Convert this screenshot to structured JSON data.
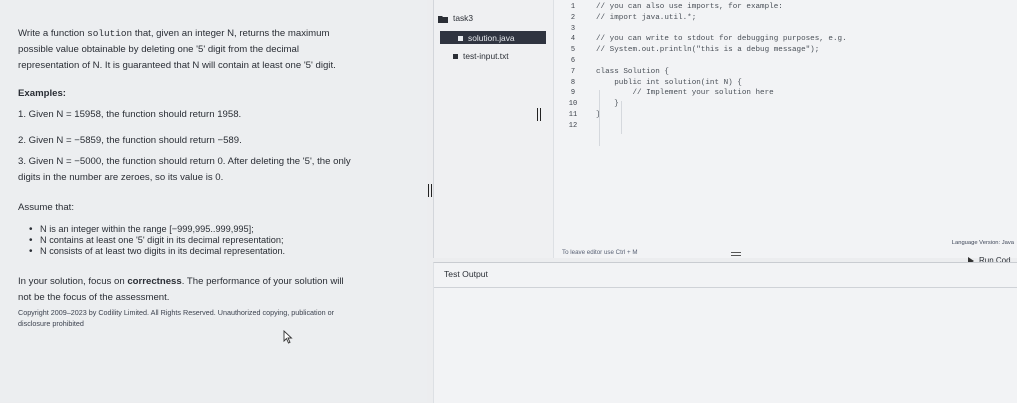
{
  "task": {
    "intro": {
      "line1_pre": "Write a function ",
      "line1_code": "solution",
      "line1_post": " that, given an integer N, returns the maximum",
      "line2": "possible value obtainable by deleting one '5' digit from the decimal",
      "line3": "representation of N. It is guaranteed that N will contain at least one '5' digit."
    },
    "examples_heading": "Examples:",
    "example1": "1. Given N = 15958, the function should return 1958.",
    "example2": "2. Given N = −5859, the function should return −589.",
    "example3_line1": "3. Given N = −5000, the function should return 0. After deleting the '5', the only",
    "example3_line2": "digits in the number are zeroes, so its value is 0.",
    "assume": "Assume that:",
    "assumptions": [
      "N is an integer within the range [−999,995..999,995];",
      "N contains at least one '5' digit in its decimal representation;",
      "N consists of at least two digits in its decimal representation."
    ],
    "focus": {
      "pre": "In your solution, focus on ",
      "bold": "correctness",
      "post": ". The performance of your solution will",
      "line2": "not be the focus of the assessment."
    },
    "copyright_line1": "Copyright 2009–2023 by Codility Limited. All Rights Reserved. Unauthorized copying, publication or",
    "copyright_line2": "disclosure prohibited"
  },
  "file_tree": {
    "folder": "task3",
    "files": [
      "solution.java",
      "test-input.txt"
    ],
    "selected": "solution.java"
  },
  "editor": {
    "line_numbers": [
      "1",
      "2",
      "3",
      "4",
      "5",
      "6",
      "7",
      "8",
      "9",
      "10",
      "11",
      "12"
    ],
    "lines": [
      "// you can also use imports, for example:",
      "// import java.util.*;",
      "",
      "// you can write to stdout for debugging purposes, e.g.",
      "// System.out.println(\"this is a debug message\");",
      "",
      "class Solution {",
      "    public int solution(int N) {",
      "        // Implement your solution here",
      "    }",
      "}",
      ""
    ],
    "hint": "To leave editor use Ctrl + M"
  },
  "toolbar": {
    "language": "Language Version: Java",
    "run_label": "Run Cod"
  },
  "output": {
    "tab_label": "Test Output"
  },
  "colors": {
    "selected_file_bg": "#2f3440",
    "panel_bg": "#eceef0",
    "editor_bg": "#f2f3f5"
  }
}
